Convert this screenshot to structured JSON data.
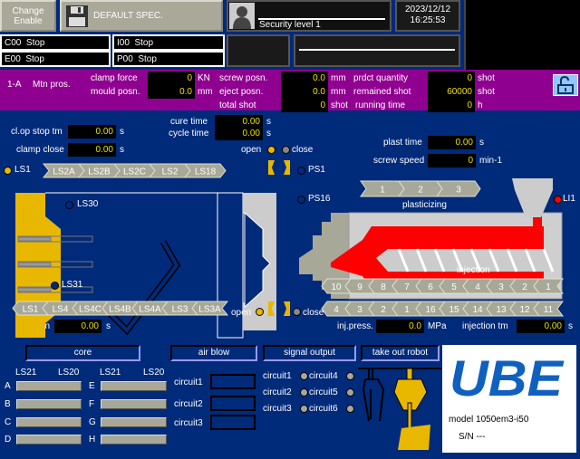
{
  "header": {
    "change_enable": "Change\nEnable",
    "spec": "DEFAULT SPEC.",
    "security": "Security level 1",
    "date": "2023/12/12",
    "time": "16:25:53"
  },
  "status": [
    {
      "code": "C00",
      "state": "Stop"
    },
    {
      "code": "E00",
      "state": "Stop"
    },
    {
      "code": "I00",
      "state": "Stop"
    },
    {
      "code": "P00",
      "state": "Stop"
    }
  ],
  "info": {
    "mode": "1-A",
    "process": "Mtn pros.",
    "rows": [
      {
        "l1": "clamp force",
        "v1": "0",
        "u1": "KN",
        "l2": "screw posn.",
        "v2": "0.0",
        "u2": "mm",
        "l3": "prdct quantity",
        "v3": "0",
        "u3": "shot"
      },
      {
        "l1": "mould posn.",
        "v1": "0.0",
        "u1": "mm",
        "l2": "eject posn.",
        "v2": "0.0",
        "u2": "mm",
        "l3": "remained shot",
        "v3": "60000",
        "u3": "shot"
      },
      {
        "l2": "total shot",
        "v2": "0",
        "u2": "shot",
        "l3": "running time",
        "v3": "0",
        "u3": "h"
      }
    ]
  },
  "timers": {
    "clop_stop": {
      "label": "cl.op stop tm",
      "value": "0.00",
      "unit": "s"
    },
    "clamp_close": {
      "label": "clamp close",
      "value": "0.00",
      "unit": "s"
    },
    "cure": {
      "label": "cure time",
      "value": "0.00",
      "unit": "s"
    },
    "cycle": {
      "label": "cycle time",
      "value": "0.00",
      "unit": "s"
    },
    "plast": {
      "label": "plast time",
      "value": "0.00",
      "unit": "s"
    },
    "screw_speed": {
      "label": "screw speed",
      "value": "0",
      "unit": "min-1"
    },
    "cl_open": {
      "label": "cl. open",
      "value": "0.00",
      "unit": "s"
    },
    "inj_press": {
      "label": "inj.press.",
      "value": "0.0",
      "unit": "MPa"
    },
    "inj_tm": {
      "label": "injection tm",
      "value": "0.00",
      "unit": "s"
    }
  },
  "machine": {
    "open": "open",
    "close": "close",
    "ls1": "LS1",
    "ls30": "LS30",
    "ls31": "LS31",
    "ps1": "PS1",
    "ps16": "PS16",
    "li1": "LI1",
    "plasticizing": "plasticizing",
    "injection": "injection",
    "top_ls": [
      "LS2A",
      "LS2B",
      "LS2C",
      "LS2",
      "LS18"
    ],
    "bottom_ls": [
      "LS1",
      "LS4",
      "LS4C",
      "LS4B",
      "LS4A",
      "LS3",
      "LS3A"
    ],
    "plast_steps": [
      "1",
      "2",
      "3"
    ],
    "inj_row1": [
      "10",
      "9",
      "8",
      "7",
      "6",
      "5",
      "4",
      "3",
      "2",
      "1"
    ],
    "inj_row2": [
      "4",
      "3",
      "2",
      "1",
      "16",
      "15",
      "14",
      "13",
      "12",
      "11"
    ]
  },
  "core": {
    "button": "core",
    "ls21": "LS21",
    "ls20": "LS20",
    "left": [
      "A",
      "B",
      "C",
      "D"
    ],
    "right": [
      "E",
      "F",
      "G",
      "H"
    ]
  },
  "air_blow": {
    "button": "air blow",
    "circuits": [
      "circuit1",
      "circuit2",
      "circuit3"
    ]
  },
  "signal_output": {
    "button": "signal output",
    "circuits": [
      "circuit1",
      "circuit4",
      "circuit2",
      "circuit5",
      "circuit3",
      "circuit6"
    ]
  },
  "robot": {
    "button": "take out robot"
  },
  "brand": {
    "logo": "UBE",
    "model": "model 1050em3-i50",
    "sn": "S/N ---"
  },
  "colors": {
    "background": "#002a7a",
    "info_band": "#900090",
    "value_text": "#e8e000",
    "yellow": "#e8b800",
    "led_red": "#ff0000"
  }
}
